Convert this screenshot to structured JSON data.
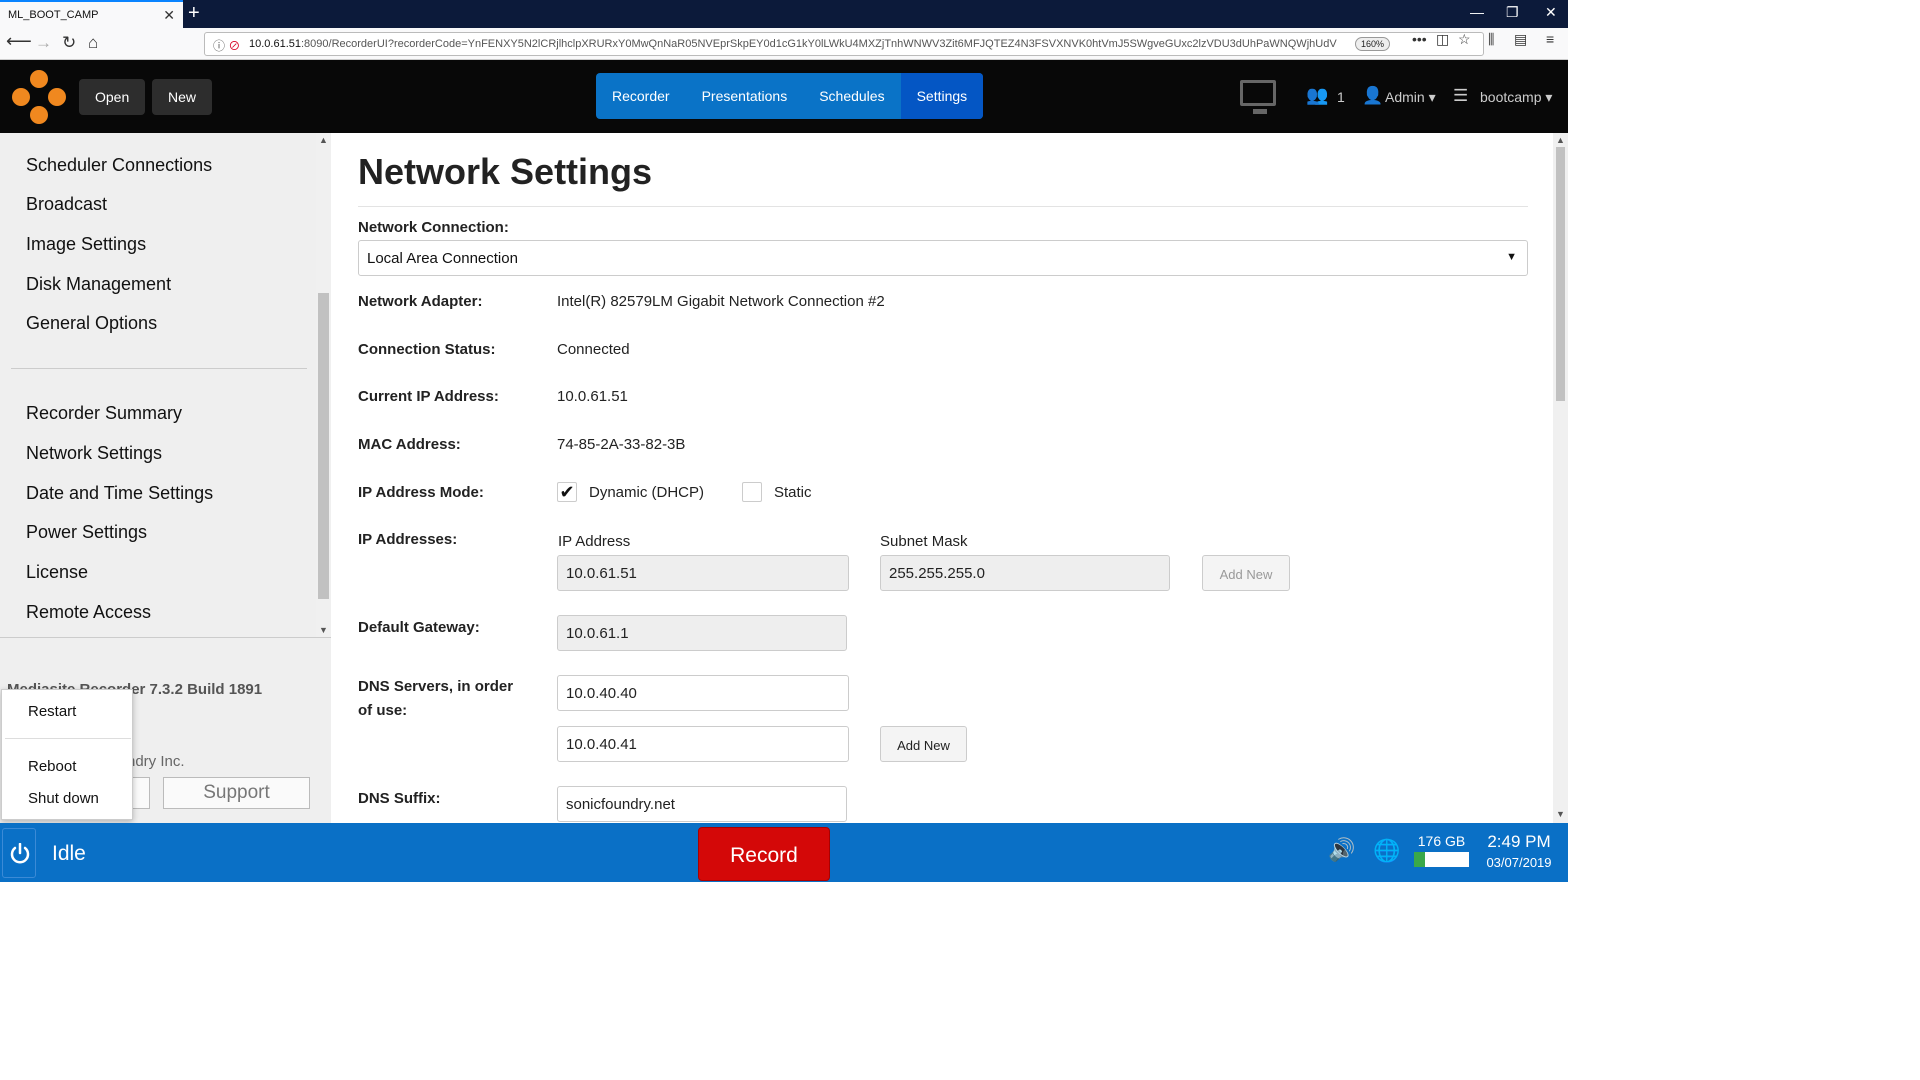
{
  "browser": {
    "tab_title": "ML_BOOT_CAMP",
    "tab_close": "✕",
    "new_tab": "+",
    "url_host": "10.0.61.51",
    "url_rest": ":8090/RecorderUI?recorderCode=YnFENXY5N2lCRjlhclpXRURxY0MwQnNaR05NVEprSkpEY0d1cG1kY0lLWkU4MXZjTnhWNWV3Zit6MFJQTEZ4N3FSVXNVK0htVmJ5SWgveGUxc2lzVDU3dUhPaWNQWjhUdV",
    "zoom": "160%"
  },
  "header": {
    "open_label": "Open",
    "new_label": "New",
    "tabs": [
      "Recorder",
      "Presentations",
      "Schedules",
      "Settings"
    ],
    "viewers_count": "1",
    "user_label": "Admin",
    "server_label": "bootcamp"
  },
  "sidebar": {
    "group1": [
      "Scheduler Connections",
      "Broadcast",
      "Image Settings",
      "Disk Management",
      "General Options"
    ],
    "group2": [
      "Recorder Summary",
      "Network Settings",
      "Date and Time Settings",
      "Power Settings",
      "License",
      "Remote Access"
    ],
    "version": "Mediasite Recorder 7.3.2 Build 1891",
    "company": "ndry Inc.",
    "support_label": "Support"
  },
  "power_menu": {
    "items": [
      "Restart",
      "Reboot",
      "Shut down"
    ]
  },
  "main": {
    "title": "Network Settings",
    "network_connection_label": "Network Connection:",
    "network_connection_value": "Local Area Connection",
    "adapter_label": "Network Adapter:",
    "adapter_value": "Intel(R) 82579LM Gigabit Network Connection #2",
    "status_label": "Connection Status:",
    "status_value": "Connected",
    "current_ip_label": "Current IP Address:",
    "current_ip_value": "10.0.61.51",
    "mac_label": "MAC Address:",
    "mac_value": "74-85-2A-33-82-3B",
    "ip_mode_label": "IP Address Mode:",
    "ip_mode_dhcp": "Dynamic (DHCP)",
    "ip_mode_static": "Static",
    "ip_mode_dhcp_checked": "✔",
    "ip_addresses_label": "IP Addresses:",
    "ip_col_header": "IP Address",
    "subnet_col_header": "Subnet Mask",
    "ip_value": "10.0.61.51",
    "subnet_value": "255.255.255.0",
    "add_new_label": "Add New",
    "gateway_label": "Default Gateway:",
    "gateway_value": "10.0.61.1",
    "dns_label_1": "DNS Servers, in order",
    "dns_label_2": "of use:",
    "dns_1": "10.0.40.40",
    "dns_2": "10.0.40.41",
    "dns_suffix_label": "DNS Suffix:",
    "dns_suffix_value": "sonicfoundry.net"
  },
  "statusbar": {
    "state": "Idle",
    "record_label": "Record",
    "disk_free": "176 GB",
    "disk_used_fraction": 0.2,
    "time": "2:49 PM",
    "date": "03/07/2019"
  },
  "colors": {
    "accent": "#0a73c7",
    "active_tab": "#0456c4",
    "record": "#d40808",
    "logo": "#f0881f"
  }
}
